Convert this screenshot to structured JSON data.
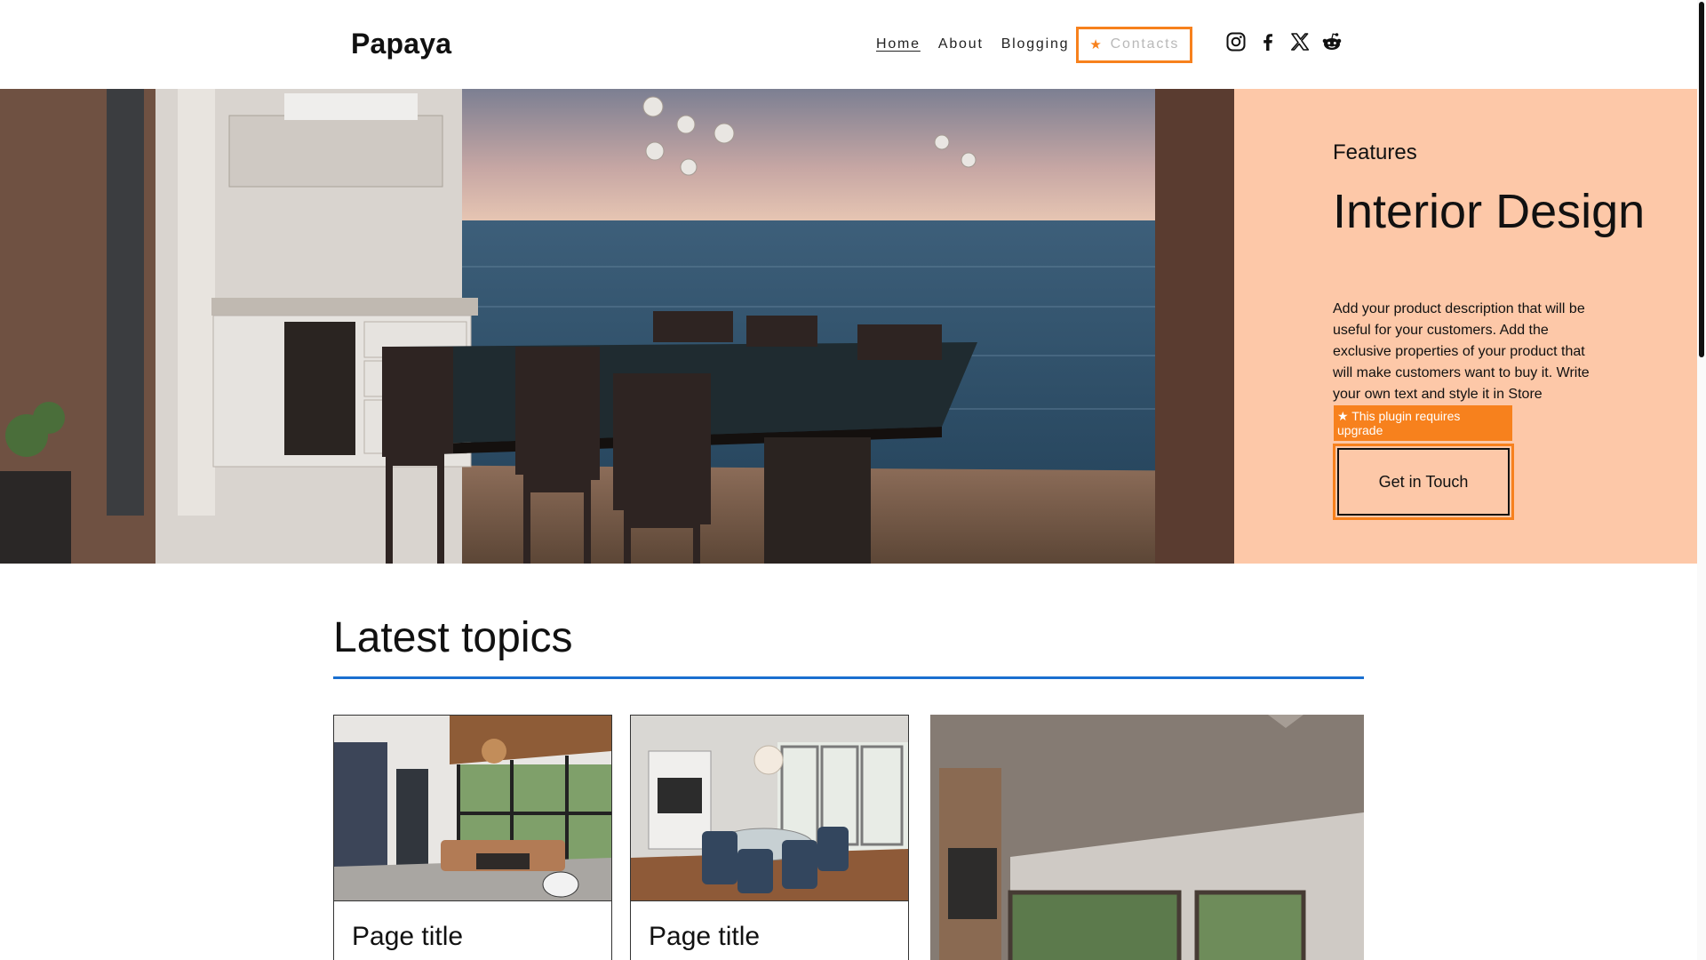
{
  "header": {
    "logo": "Papaya",
    "nav": [
      {
        "label": "Home",
        "active": true
      },
      {
        "label": "About",
        "active": false
      },
      {
        "label": "Blogging",
        "active": false
      },
      {
        "label": "Contacts",
        "active": false,
        "premium": true
      }
    ],
    "social_icons": [
      "instagram-icon",
      "facebook-icon",
      "x-icon",
      "reddit-icon"
    ]
  },
  "hero": {
    "eyebrow": "Features",
    "title": "Interior Design",
    "description": "Add your product description that will be useful for your customers. Add the exclusive properties of your product that will make customers want to buy it. Write your own text and style it in Store",
    "plugin_notice": "This plugin requires upgrade",
    "cta_label": "Get in Touch",
    "panel_color": "#fdc8a8"
  },
  "latest": {
    "title": "Latest topics",
    "cards": [
      {
        "title": "Page title"
      },
      {
        "title": "Page title"
      }
    ]
  },
  "colors": {
    "accent": "#f7811d",
    "rule": "#1a6fd0"
  }
}
